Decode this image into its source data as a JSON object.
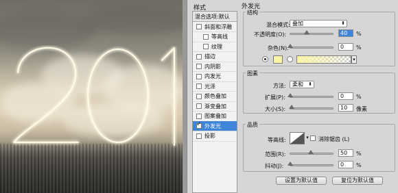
{
  "canvas": {
    "digits": "201"
  },
  "styles_panel": {
    "title": "样式",
    "header": "混合选项:默认",
    "items": [
      {
        "label": "斜面和浮雕",
        "checked": false,
        "indent": false,
        "selected": false
      },
      {
        "label": "等高线",
        "checked": false,
        "indent": true,
        "selected": false
      },
      {
        "label": "纹理",
        "checked": false,
        "indent": true,
        "selected": false
      },
      {
        "label": "描边",
        "checked": false,
        "indent": false,
        "selected": false
      },
      {
        "label": "内阴影",
        "checked": false,
        "indent": false,
        "selected": false
      },
      {
        "label": "内发光",
        "checked": false,
        "indent": false,
        "selected": false
      },
      {
        "label": "光泽",
        "checked": false,
        "indent": false,
        "selected": false
      },
      {
        "label": "颜色叠加",
        "checked": false,
        "indent": false,
        "selected": false
      },
      {
        "label": "渐变叠加",
        "checked": false,
        "indent": false,
        "selected": false
      },
      {
        "label": "图案叠加",
        "checked": false,
        "indent": false,
        "selected": false
      },
      {
        "label": "外发光",
        "checked": true,
        "indent": false,
        "selected": true
      },
      {
        "label": "投影",
        "checked": false,
        "indent": false,
        "selected": false
      }
    ]
  },
  "outer_glow": {
    "title": "外发光",
    "structure": {
      "title": "结构",
      "blend_mode_label": "混合模式:",
      "blend_mode_value": "叠加",
      "opacity_label": "不透明度(O):",
      "opacity_value": "40",
      "opacity_unit": "%",
      "opacity_fraction": 0.4,
      "noise_label": "杂色(N):",
      "noise_value": "0",
      "noise_unit": "%",
      "noise_fraction": 0.0,
      "glow_color": "#fbf5a8"
    },
    "elements": {
      "title": "图素",
      "technique_label": "方法:",
      "technique_value": "柔和",
      "spread_label": "扩展(P):",
      "spread_value": "0",
      "spread_unit": "%",
      "spread_fraction": 0.0,
      "size_label": "大小(S):",
      "size_value": "10",
      "size_unit": "像素",
      "size_fraction": 0.04
    },
    "quality": {
      "title": "品质",
      "contour_label": "等高线:",
      "antialias_label": "消除锯齿 (L)",
      "range_label": "范围(R):",
      "range_value": "50",
      "range_unit": "%",
      "range_fraction": 0.5,
      "jitter_label": "抖动(J):",
      "jitter_value": "0",
      "jitter_unit": "%",
      "jitter_fraction": 0.0
    },
    "set_default_button": "设置为默认值",
    "reset_default_button": "复位为默认值"
  }
}
